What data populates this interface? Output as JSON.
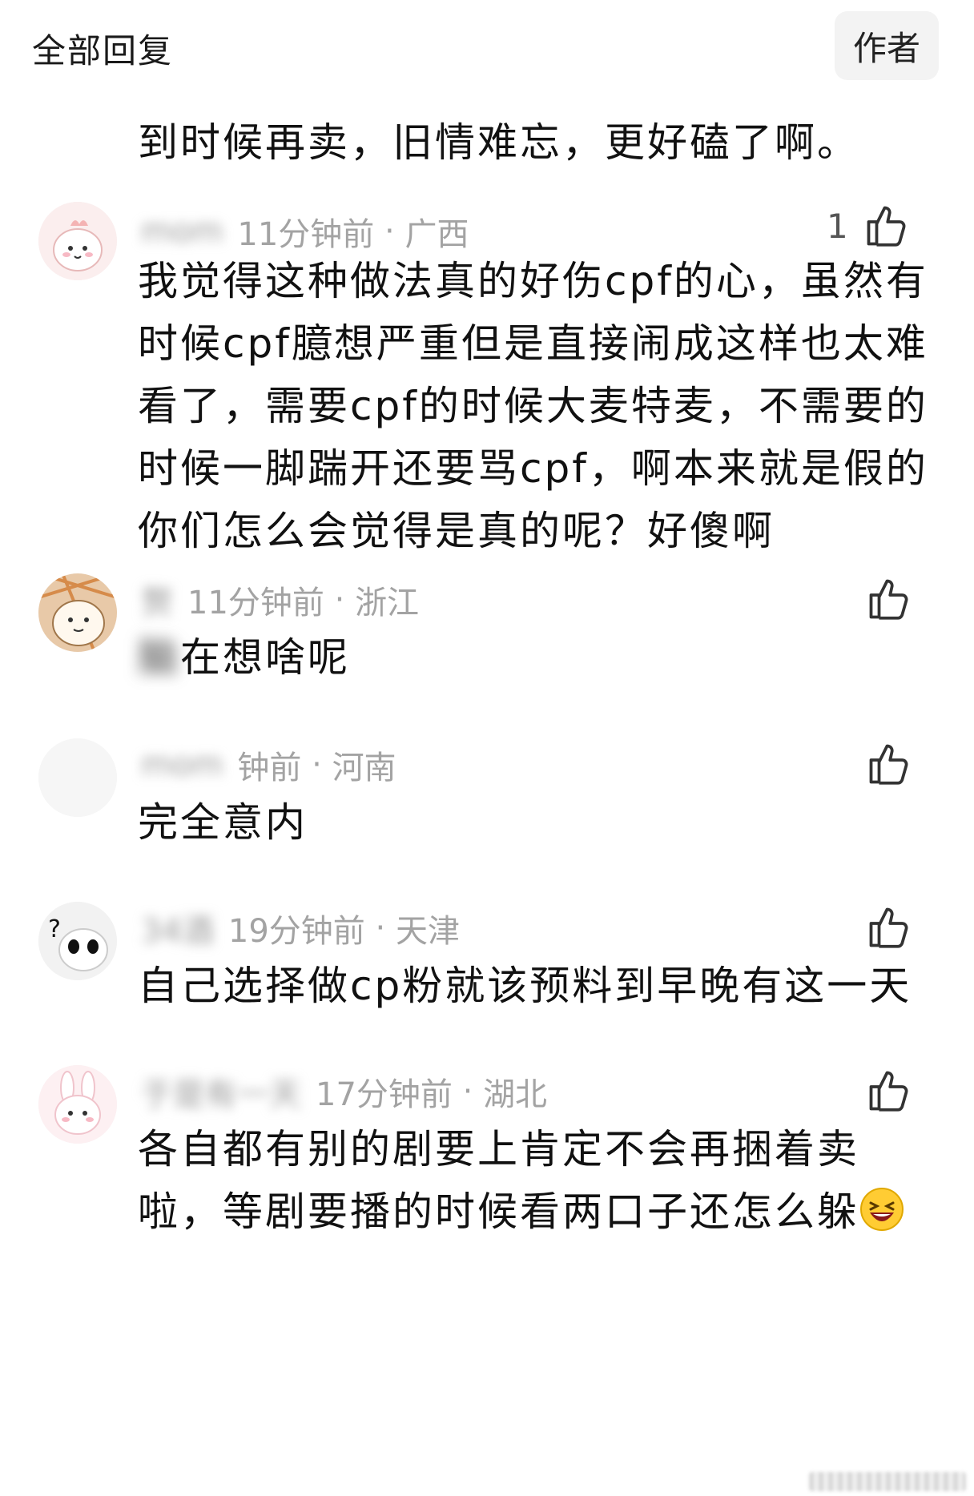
{
  "header": {
    "title": "全部回复",
    "author_label": "作者"
  },
  "top_comment": {
    "text": "到时候再卖，旧情难忘，更好磕了啊。"
  },
  "comments": [
    {
      "username": "mom",
      "time": "11分钟前",
      "region": "广西",
      "likes": "1",
      "text": "我觉得这种做法真的好伤cpf的心，虽然有时候cpf臆想严重但是直接闹成这样也太难看了，需要cpf的时候大麦特麦，不需要的时候一脚踹开还要骂cpf，啊本来就是假的你们怎么会觉得是真的呢？好傻啊",
      "avatar_icon": "bunny-avatar-icon"
    },
    {
      "username": "赘",
      "time": "11分钟前",
      "region": "浙江",
      "likes": "",
      "text_blurred": "脑",
      "text": "在想啥呢",
      "avatar_icon": "cartoon-avatar-icon"
    },
    {
      "username": "mom",
      "time": "钟前",
      "region": "河南",
      "likes": "",
      "text": "完全意内",
      "avatar_icon": "blank-avatar-icon"
    },
    {
      "username": "34酒",
      "time": "19分钟前",
      "region": "天津",
      "likes": "",
      "text": "自己选择做cp粉就该预料到早晚有这一天",
      "avatar_icon": "panda-avatar-icon"
    },
    {
      "username": "于是有一天",
      "time": "17分钟前",
      "region": "湖北",
      "likes": "",
      "text": "各自都有别的剧要上肯定不会再捆着卖啦，等剧要播的时候看两口子还怎么躲",
      "emoji": "laughing-emoji-icon",
      "avatar_icon": "pink-bunny-avatar-icon"
    }
  ],
  "colors": {
    "meta": "#a3a3a3",
    "text": "#111111",
    "author_bg": "#f3f3f3"
  }
}
